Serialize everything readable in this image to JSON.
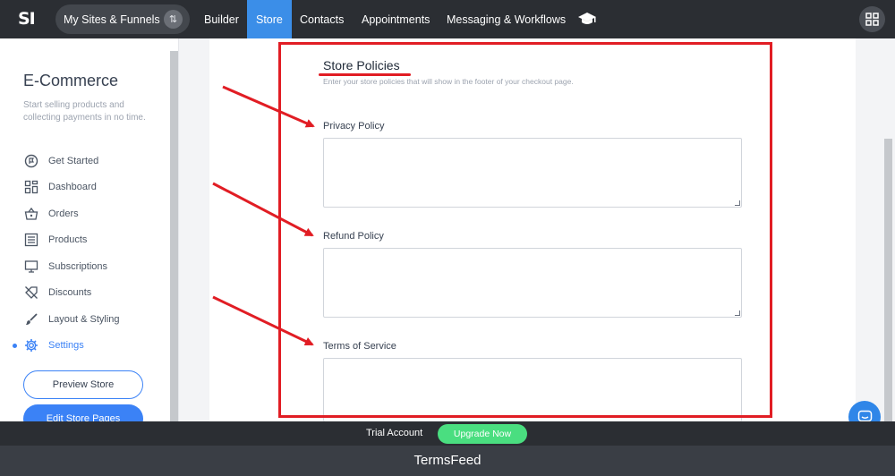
{
  "topbar": {
    "logo": "SI",
    "sites_label": "My Sites & Funnels",
    "swap_icon": "swap-arrows-icon",
    "nav": [
      {
        "label": "Builder",
        "active": false
      },
      {
        "label": "Store",
        "active": true
      },
      {
        "label": "Contacts",
        "active": false
      },
      {
        "label": "Appointments",
        "active": false
      },
      {
        "label": "Messaging & Workflows",
        "active": false
      }
    ],
    "academy_icon": "graduation-cap-icon",
    "apps_icon": "apps-grid-icon"
  },
  "sidebar": {
    "title": "E-Commerce",
    "description": "Start selling products and collecting payments in no time.",
    "items": [
      {
        "label": "Get Started",
        "icon": "flag-circle-icon"
      },
      {
        "label": "Dashboard",
        "icon": "dashboard-icon"
      },
      {
        "label": "Orders",
        "icon": "basket-icon"
      },
      {
        "label": "Products",
        "icon": "list-icon"
      },
      {
        "label": "Subscriptions",
        "icon": "monitor-icon"
      },
      {
        "label": "Discounts",
        "icon": "tag-off-icon"
      },
      {
        "label": "Layout & Styling",
        "icon": "brush-icon"
      },
      {
        "label": "Settings",
        "icon": "gear-icon",
        "active": true
      }
    ],
    "preview_button": "Preview Store",
    "edit_button": "Edit Store Pages"
  },
  "main": {
    "title": "Store Policies",
    "subtitle": "Enter your store policies that will show in the footer of your checkout page.",
    "fields": [
      {
        "label": "Privacy Policy",
        "value": ""
      },
      {
        "label": "Refund Policy",
        "value": ""
      },
      {
        "label": "Terms of Service",
        "value": ""
      }
    ]
  },
  "trialbar": {
    "text": "Trial Account",
    "upgrade_button": "Upgrade Now"
  },
  "footer": {
    "brand": "TermsFeed"
  },
  "colors": {
    "accent": "#3b8ee8",
    "annotation": "#e11d24",
    "upgrade": "#4ade80",
    "topbar": "#2b2e33"
  }
}
